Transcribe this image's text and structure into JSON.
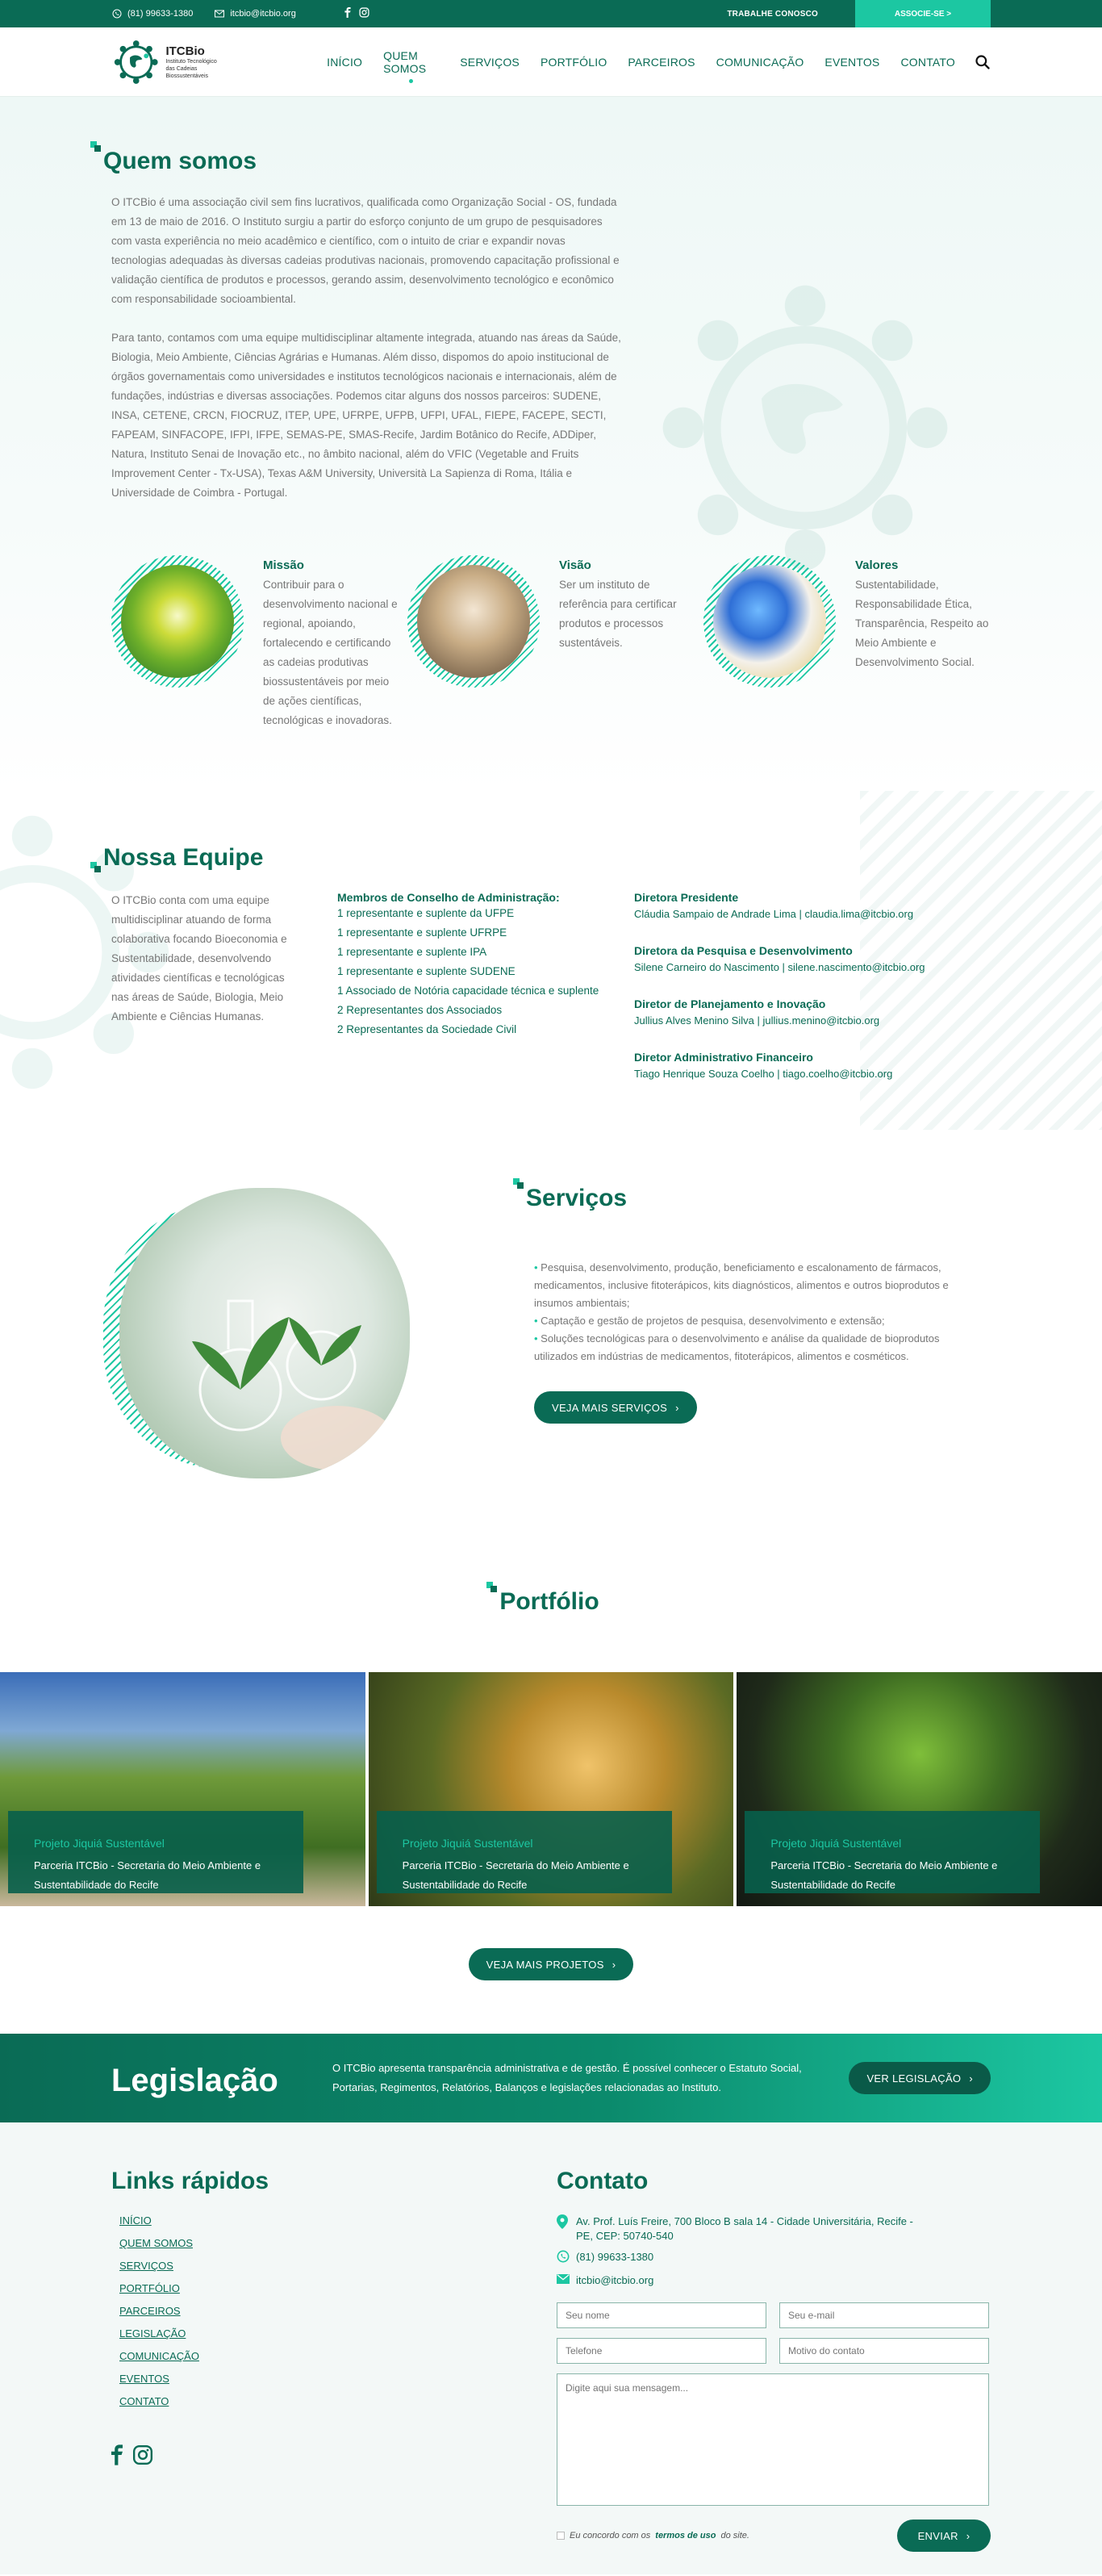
{
  "colors": {
    "primary": "#0a6b55",
    "accent": "#1cc7a2"
  },
  "topbar": {
    "phone": "(81) 99633-1380",
    "email": "itcbio@itcbio.org",
    "work_with_us": "TRABALHE CONOSCO",
    "join": "ASSOCIE-SE >"
  },
  "header": {
    "logo_name": "ITCBio",
    "logo_tagline_1": "Instituto Tecnológico",
    "logo_tagline_2": "das Cadeias Biossustentáveis",
    "nav": [
      "INÍCIO",
      "QUEM SOMOS",
      "SERVIÇOS",
      "PORTFÓLIO",
      "PARCEIROS",
      "COMUNICAÇÃO",
      "EVENTOS",
      "CONTATO"
    ]
  },
  "about": {
    "title": "Quem somos",
    "p1": "O ITCBio é uma associação civil sem fins lucrativos, qualificada como Organização Social - OS, fundada em 13 de maio de 2016. O Instituto surgiu a partir do esforço conjunto de um grupo de pesquisadores com vasta experiência no meio acadêmico e científico, com o intuito de criar e expandir novas tecnologias adequadas às diversas cadeias produtivas nacionais, promovendo capacitação profissional e validação científica de produtos e processos, gerando assim, desenvolvimento tecnológico e econômico com responsabilidade socioambiental.",
    "p2": "Para tanto, contamos com uma equipe multidisciplinar altamente integrada, atuando nas áreas da Saúde, Biologia, Meio Ambiente, Ciências Agrárias e Humanas. Além disso, dispomos do apoio institucional de órgãos governamentais como universidades e institutos tecnológicos nacionais e internacionais, além de fundações, indústrias e diversas associações. Podemos citar alguns dos nossos parceiros: SUDENE, INSA, CETENE, CRCN, FIOCRUZ, ITEP, UPE, UFRPE, UFPB, UFPI, UFAL, FIEPE, FACEPE, SECTI, FAPEAM, SINFACOPE, IFPI, IFPE, SEMAS-PE, SMAS-Recife, Jardim Botânico do Recife, ADDiper, Natura, Instituto Senai de Inovação etc., no âmbito nacional, além do VFIC (Vegetable and Fruits Improvement Center - Tx-USA), Texas A&M University, Università La Sapienza di Roma, Itália e Universidade de Coimbra - Portugal.",
    "cards": [
      {
        "title": "Missão",
        "text": "Contribuir para o desenvolvimento nacional e regional, apoiando, fortalecendo e certificando as cadeias produtivas biossustentáveis por meio de ações científicas, tecnológicas e inovadoras."
      },
      {
        "title": "Visão",
        "text": "Ser um instituto de referência para certificar produtos e processos sustentáveis."
      },
      {
        "title": "Valores",
        "text": "Sustentabilidade, Responsabilidade Ética, Transparência, Respeito ao Meio Ambiente e Desenvolvimento Social."
      }
    ]
  },
  "team": {
    "title": "Nossa Equipe",
    "intro": "O ITCBio conta com uma equipe multidisciplinar atuando de forma colaborativa focando Bioeconomia e Sustentabilidade, desenvolvendo atividades científicas e tecnológicas nas áreas de Saúde, Biologia, Meio Ambiente e Ciências Humanas.",
    "board_title": "Membros de Conselho de Administração:",
    "board": [
      "1 representante e suplente da UFPE",
      "1 representante e suplente UFRPE",
      "1 representante e suplente IPA",
      "1 representante e suplente SUDENE",
      "1 Associado de Notória capacidade técnica e suplente",
      "2 Representantes dos Associados",
      "2 Representantes da Sociedade Civil"
    ],
    "directors": [
      {
        "role": "Diretora Presidente",
        "name": "Cláudia Sampaio de Andrade Lima | claudia.lima@itcbio.org"
      },
      {
        "role": "Diretora da Pesquisa e Desenvolvimento",
        "name": "Silene Carneiro do Nascimento | silene.nascimento@itcbio.org"
      },
      {
        "role": "Diretor de Planejamento e Inovação",
        "name": "Jullius Alves Menino Silva | jullius.menino@itcbio.org"
      },
      {
        "role": "Diretor Administrativo Financeiro",
        "name": "Tiago Henrique Souza Coelho | tiago.coelho@itcbio.org"
      }
    ]
  },
  "services": {
    "title": "Serviços",
    "items": [
      "Pesquisa, desenvolvimento, produção, beneficiamento e escalonamento de fármacos, medicamentos, inclusive fitoterápicos, kits diagnósticos, alimentos e outros bioprodutos e insumos ambientais;",
      "Captação e gestão de projetos de pesquisa, desenvolvimento e extensão;",
      "Soluções tecnológicas para o desenvolvimento e análise da qualidade de bioprodutos utilizados em indústrias de medicamentos, fitoterápicos, alimentos e cosméticos."
    ],
    "button": "VEJA MAIS SERVIÇOS"
  },
  "portfolio": {
    "title": "Portfólio",
    "projects": [
      {
        "title": "Projeto Jiquiá Sustentável",
        "desc": "Parceria ITCBio - Secretaria do Meio Ambiente e Sustentabilidade do Recife"
      },
      {
        "title": "Projeto Jiquiá Sustentável",
        "desc": "Parceria ITCBio - Secretaria do Meio Ambiente e Sustentabilidade do Recife"
      },
      {
        "title": "Projeto Jiquiá Sustentável",
        "desc": "Parceria ITCBio - Secretaria do Meio Ambiente e Sustentabilidade do Recife"
      }
    ],
    "button": "VEJA MAIS PROJETOS"
  },
  "legislation": {
    "title": "Legislação",
    "text": "O ITCBio apresenta transparência administrativa e de gestão. É possível conhecer o Estatuto Social, Portarias, Regimentos, Relatórios, Balanços e legislações relacionadas ao Instituto.",
    "button": "VER LEGISLAÇÃO"
  },
  "footer": {
    "links_title": "Links rápidos",
    "links": [
      "INÍCIO",
      "QUEM SOMOS",
      "SERVIÇOS",
      "PORTFÓLIO",
      "PARCEIROS",
      "LEGISLAÇÃO",
      "COMUNICAÇÃO",
      "EVENTOS",
      "CONTATO"
    ],
    "contact_title": "Contato",
    "address": "Av. Prof. Luís Freire, 700 Bloco B sala 14 - Cidade Universitária, Recife - PE, CEP: 50740-540",
    "phone": "(81) 99633-1380",
    "email": "itcbio@itcbio.org",
    "form": {
      "name_placeholder": "Seu nome",
      "email_placeholder": "Seu e-mail",
      "phone_placeholder": "Telefone",
      "reason_placeholder": "Motivo do contato",
      "message_placeholder": "Digite aqui sua mensagem...",
      "agree_prefix": "Eu concordo com os",
      "agree_terms": "termos de uso",
      "agree_suffix": "do site.",
      "submit": "ENVIAR"
    }
  }
}
